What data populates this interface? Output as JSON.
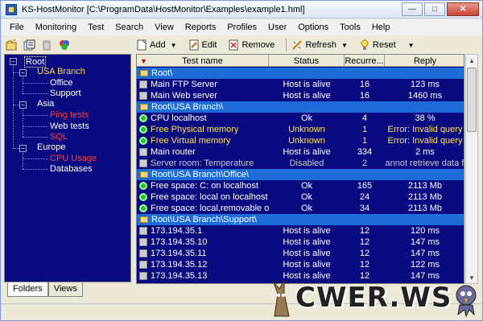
{
  "window": {
    "title": "KS-HostMonitor  [C:\\ProgramData\\HostMonitor\\Examples\\example1.hml]"
  },
  "menu": [
    "File",
    "Monitoring",
    "Test",
    "Search",
    "View",
    "Reports",
    "Profiles",
    "User",
    "Options",
    "Tools",
    "Help"
  ],
  "toolbar": {
    "add_label": "Add",
    "edit_label": "Edit",
    "remove_label": "Remove",
    "refresh_label": "Refresh",
    "reset_label": "Reset"
  },
  "tree": {
    "root": "Root",
    "usa_branch": "USA Branch",
    "office": "Office",
    "support": "Support",
    "asia": "Asia",
    "ping_tests": "Ping tests",
    "web_tests": "Web tests",
    "sql": "SQL",
    "europe": "Europe",
    "cpu_usage": "CPU Usage",
    "databases": "Databases"
  },
  "tabs": [
    "Folders",
    "Views"
  ],
  "grid": {
    "columns": [
      "Test name",
      "Status",
      "Recurre...",
      "Reply"
    ],
    "rows": [
      {
        "type": "folder",
        "name": "Root\\"
      },
      {
        "type": "test",
        "icon": "host",
        "name": "Main FTP Server",
        "status": "Host is alive",
        "rec": "16",
        "reply": "123 ms",
        "color": "#ffffff"
      },
      {
        "type": "test",
        "icon": "host",
        "name": "Main Web server",
        "status": "Host is alive",
        "rec": "16",
        "reply": "1460 ms",
        "color": "#ffffff"
      },
      {
        "type": "folder",
        "name": "Root\\USA Branch\\"
      },
      {
        "type": "test",
        "icon": "gear",
        "name": "CPU localhost",
        "status": "Ok",
        "rec": "4",
        "reply": "38 %",
        "color": "#ffffff"
      },
      {
        "type": "test",
        "icon": "gear",
        "name": "Free Physical memory",
        "status": "Unknown",
        "rec": "1",
        "reply": "Error: Invalid query",
        "color": "#ffe060"
      },
      {
        "type": "test",
        "icon": "gear",
        "name": "Free Virtual memory",
        "status": "Unknown",
        "rec": "1",
        "reply": "Error: Invalid query",
        "color": "#ffe060"
      },
      {
        "type": "test",
        "icon": "host",
        "name": "Main router",
        "status": "Host is alive",
        "rec": "334",
        "reply": "2 ms",
        "color": "#ffffff"
      },
      {
        "type": "test",
        "icon": "host",
        "name": "Server room: Temperature",
        "status": "Disabled",
        "rec": "2",
        "reply": "Cannot retrieve data f...",
        "color": "#c8c8c8"
      },
      {
        "type": "folder",
        "name": "Root\\USA Branch\\Office\\"
      },
      {
        "type": "test",
        "icon": "gear",
        "name": "Free space: C: on localhost",
        "status": "Ok",
        "rec": "165",
        "reply": "2113 Mb",
        "color": "#ffffff"
      },
      {
        "type": "test",
        "icon": "gear",
        "name": "Free space: local on localhost",
        "status": "Ok",
        "rec": "24",
        "reply": "2113 Mb",
        "color": "#ffffff"
      },
      {
        "type": "test",
        "icon": "gear",
        "name": "Free space: local,removable on loc...",
        "status": "Ok",
        "rec": "34",
        "reply": "2113 Mb",
        "color": "#ffffff"
      },
      {
        "type": "folder",
        "name": "Root\\USA Branch\\Support\\"
      },
      {
        "type": "test",
        "icon": "host",
        "name": "173.194.35.1",
        "status": "Host is alive",
        "rec": "12",
        "reply": "120 ms",
        "color": "#ffffff"
      },
      {
        "type": "test",
        "icon": "host",
        "name": "173.194.35.10",
        "status": "Host is alive",
        "rec": "12",
        "reply": "147 ms",
        "color": "#ffffff"
      },
      {
        "type": "test",
        "icon": "host",
        "name": "173.194.35.11",
        "status": "Host is alive",
        "rec": "12",
        "reply": "147 ms",
        "color": "#ffffff"
      },
      {
        "type": "test",
        "icon": "host",
        "name": "173.194.35.12",
        "status": "Host is alive",
        "rec": "12",
        "reply": "122 ms",
        "color": "#ffffff"
      },
      {
        "type": "test",
        "icon": "host",
        "name": "173.194.35.13",
        "status": "Host is alive",
        "rec": "12",
        "reply": "147 ms",
        "color": "#ffffff"
      }
    ]
  },
  "watermark": {
    "text": "CWER.WS"
  },
  "colors": {
    "panel_bg": "#0a0a80",
    "folder_row": "#1e6cd8",
    "warning_text": "#ffe060",
    "tree_yellow": "#ffd84a",
    "tree_red": "#ff4040"
  }
}
